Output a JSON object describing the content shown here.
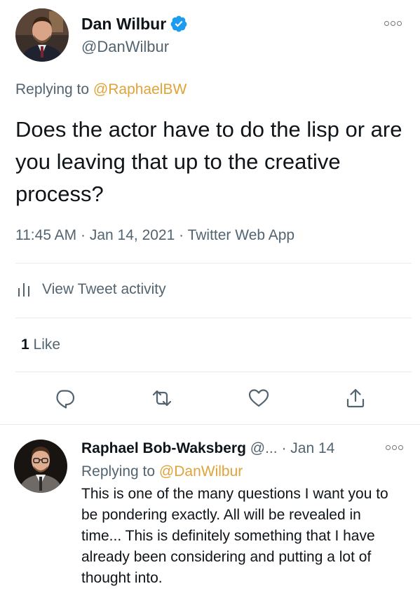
{
  "tweet": {
    "author_name": "Dan Wilbur",
    "author_handle": "@DanWilbur",
    "verified": true,
    "replying_prefix": "Replying to ",
    "replying_to": "@RaphaelBW",
    "text": "Does the actor have to do the lisp or are you leaving that up to the creative process?",
    "time": "11:45 AM",
    "date": "Jan 14, 2021",
    "source": "Twitter Web App",
    "meta_separator": " · ",
    "activity_label": "View Tweet activity",
    "likes_count": "1",
    "likes_label": " Like"
  },
  "actions": {
    "reply_icon": "reply-icon",
    "retweet_icon": "retweet-icon",
    "like_icon": "heart-icon",
    "share_icon": "share-icon"
  },
  "reply": {
    "author_name": "Raphael Bob-Waksberg",
    "author_handle": "@...",
    "separator": " · ",
    "date": "Jan 14",
    "replying_prefix": "Replying to ",
    "replying_to": "@DanWilbur",
    "text": "This is one of the many questions I want you to be pondering exactly. All will be revealed in time... This is definitely something that I have already been considering and putting a lot of thought into."
  },
  "colors": {
    "accent": "#e0a33a",
    "verified": "#1d9bf0",
    "muted": "#536471",
    "text": "#0f1419",
    "divider": "#e6ecf0"
  }
}
